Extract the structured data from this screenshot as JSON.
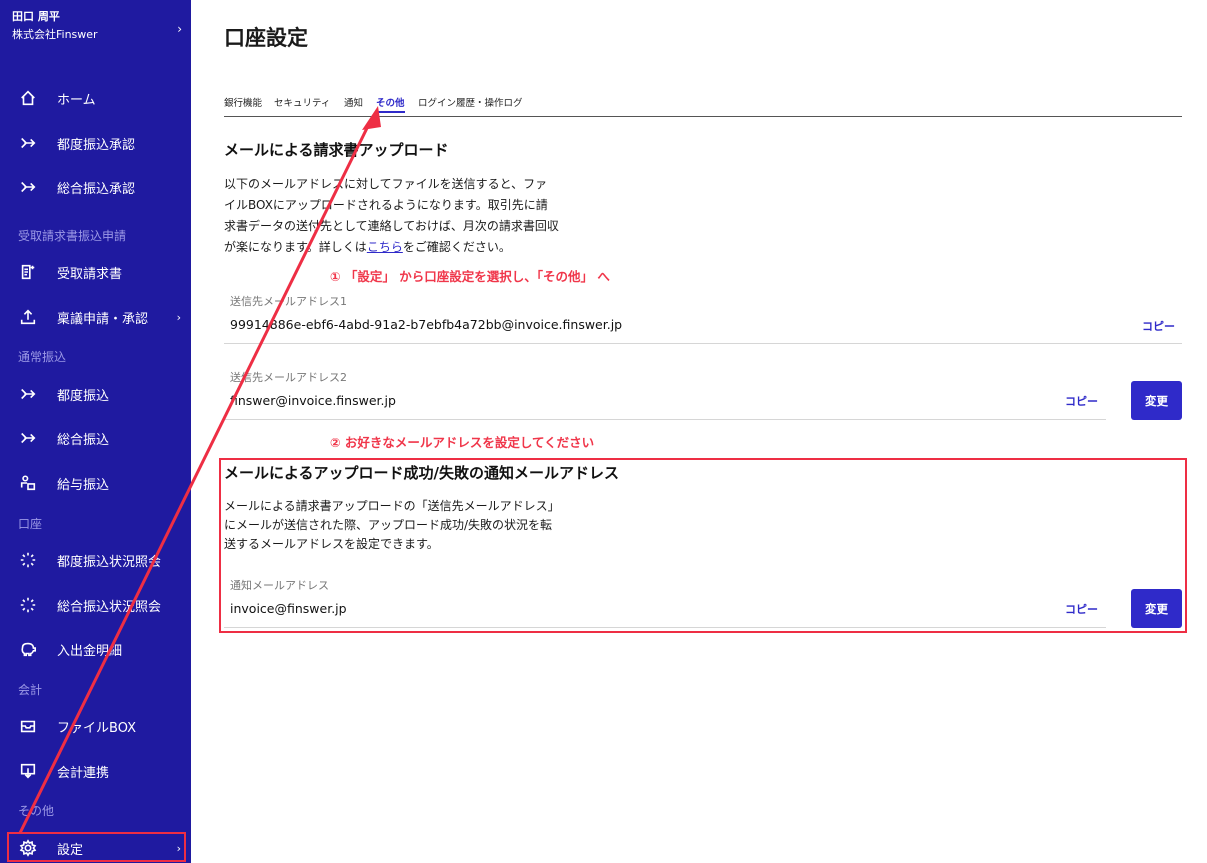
{
  "sidebar": {
    "user_name": "田口 周平",
    "company": "株式会社Finswer",
    "sections": {
      "receivable": "受取請求書振込申請",
      "normal": "通常振込",
      "account": "口座",
      "accounting": "会計",
      "other": "その他"
    },
    "items": {
      "home": "ホーム",
      "each_approval": "都度振込承認",
      "bulk_approval": "総合振込承認",
      "received_invoice": "受取請求書",
      "ringi": "稟議申請・承認",
      "each_transfer": "都度振込",
      "bulk_transfer": "総合振込",
      "salary_transfer": "給与振込",
      "each_status": "都度振込状況照会",
      "bulk_status": "総合振込状況照会",
      "statement": "入出金明細",
      "filebox": "ファイルBOX",
      "accounting_link": "会計連携",
      "settings": "設定"
    }
  },
  "page": {
    "title": "口座設定",
    "tabs": [
      "銀行機能",
      "セキュリティ",
      "通知",
      "その他",
      "ログイン履歴・操作ログ"
    ],
    "active_tab": "その他"
  },
  "upload_section": {
    "heading": "メールによる請求書アップロード",
    "description_before_link": "以下のメールアドレスに対してファイルを送信すると、ファイルBOXにアップロードされるようになります。取引先に請求書データの送付先として連絡しておけば、月次の請求書回収が楽になります。詳しくは",
    "link_text": "こちら",
    "description_after_link": "をご確認ください。",
    "field1_label": "送信先メールアドレス1",
    "field1_value": "99914886e-ebf6-4abd-91a2-b7ebfb4a72bb@invoice.finswer.jp",
    "field2_label": "送信先メールアドレス2",
    "field2_value": "finswer@invoice.finswer.jp",
    "copy_label": "コピー",
    "change_label": "変更"
  },
  "notify_section": {
    "heading": "メールによるアップロード成功/失敗の通知メールアドレス",
    "description": "メールによる請求書アップロードの「送信先メールアドレス」にメールが送信された際、アップロード成功/失敗の状況を転送するメールアドレスを設定できます。",
    "field_label": "通知メールアドレス",
    "field_value": "invoice@finswer.jp",
    "copy_label": "コピー",
    "change_label": "変更"
  },
  "annotations": {
    "step1": "① 「設定」 から口座設定を選択し、「その他」 へ",
    "step2": "② お好きなメールアドレスを設定してください"
  },
  "colors": {
    "sidebar_bg": "#1f1aa0",
    "accent": "#2f2ac9",
    "annotation_red": "#ee2e44"
  }
}
